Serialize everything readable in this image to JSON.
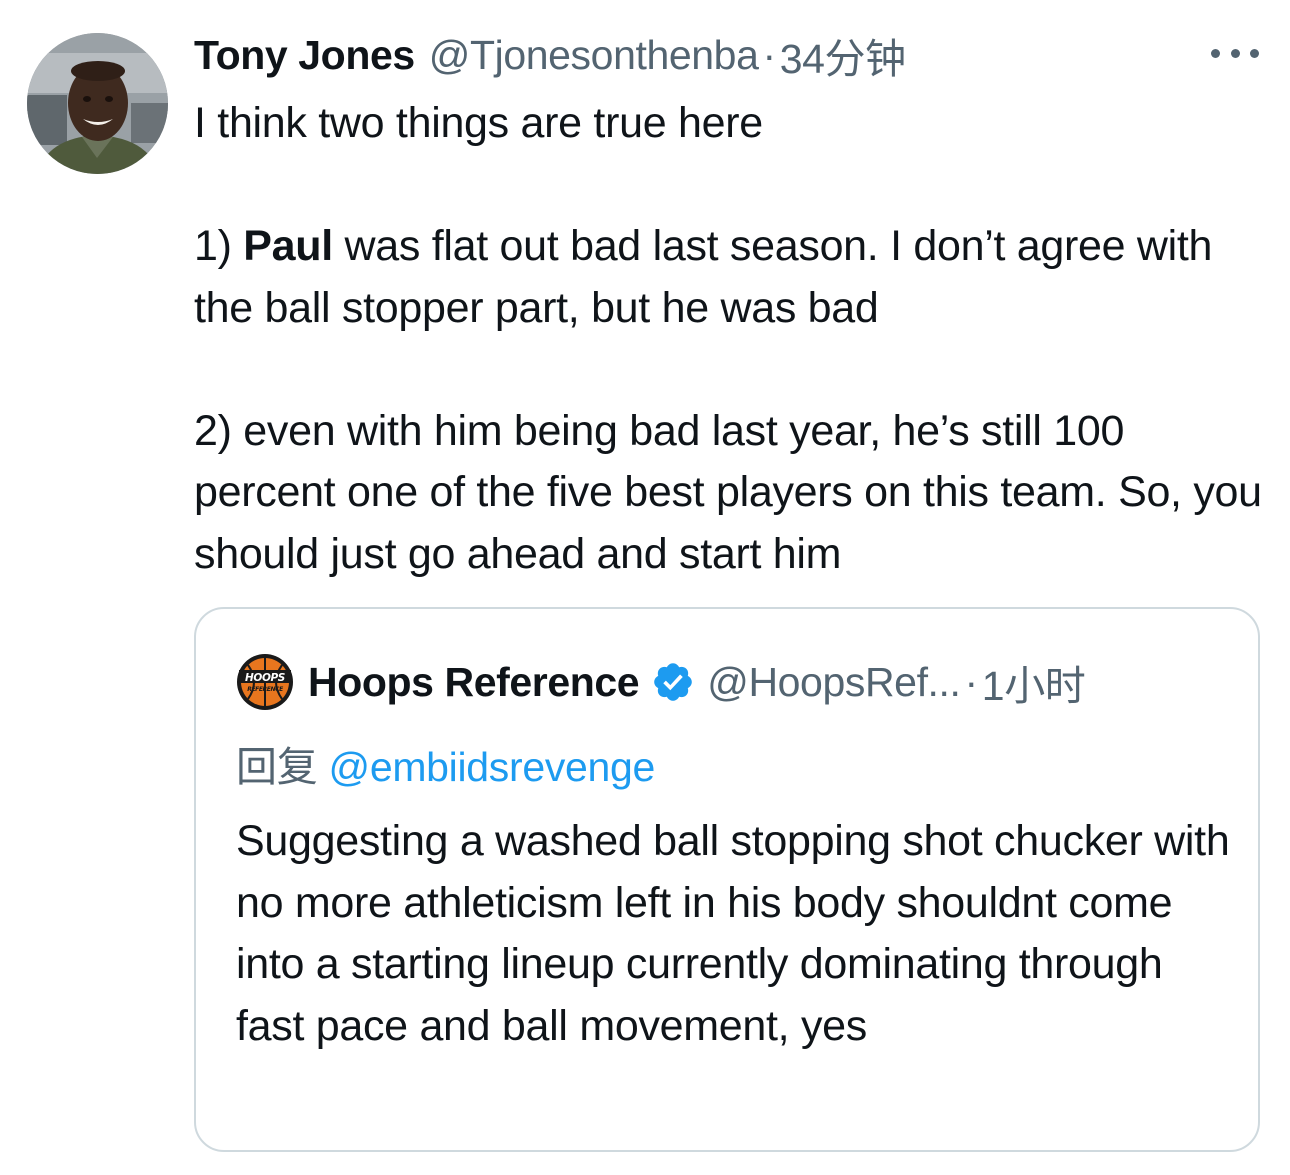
{
  "tweet": {
    "author_name": "Tony Jones",
    "author_handle": "@Tjonesonthenba",
    "separator": "·",
    "time": "34分钟",
    "avatar_icon": "user-avatar-photo",
    "more_icon": "more-horizontal-icon",
    "lines": {
      "intro": "I think two things are true here",
      "point1_prefix": "1) ",
      "point1_bold": "Paul",
      "point1_rest": " was flat out bad last season. I don’t agree with the ball stopper part, but he was bad",
      "point2": "2) even with him being bad last year, he’s still 100 percent one of the five best players on this team. So, you should just go ahead and start him"
    }
  },
  "quoted_tweet": {
    "logo_icon": "hoops-reference-logo",
    "logo_text": "HOOPS",
    "logo_subtext": "REFERENCE",
    "author_name": "Hoops Reference",
    "verified_icon": "verified-badge-icon",
    "author_handle": "@HoopsRef...",
    "separator": "·",
    "time": "1小时",
    "reply_prefix": "回复",
    "reply_mention": "@embiidsrevenge",
    "text": "Suggesting a washed ball stopping shot chucker with no more athleticism left in his body shouldnt come into a starting lineup currently dominating through fast pace and ball movement, yes"
  },
  "colors": {
    "text_primary": "#0f1419",
    "text_secondary": "#536471",
    "link": "#1d9bf0",
    "border": "#cfd9de",
    "logo_orange": "#e8761e"
  }
}
